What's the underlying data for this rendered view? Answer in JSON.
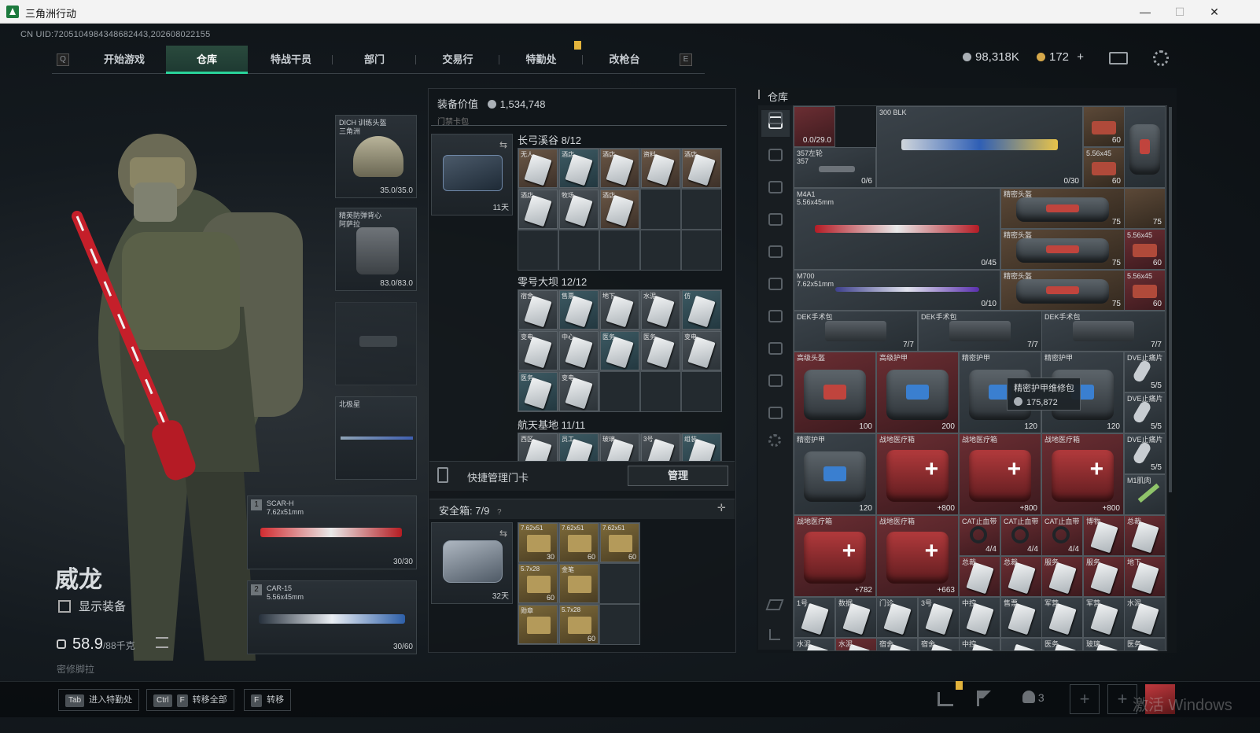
{
  "window": {
    "title": "三角洲行动",
    "minimize": "—",
    "maximize": "☐",
    "close": "✕"
  },
  "uid": "CN UID:7205104984348682443,202608022155",
  "nav": {
    "left_key": "Q",
    "right_key": "E",
    "tabs": [
      "开始游戏",
      "仓库",
      "特战干员",
      "部门",
      "交易行",
      "特勤处",
      "改枪台"
    ],
    "active": "仓库"
  },
  "currency": {
    "silver": "98,318K",
    "gold": "172",
    "gold_add": "+"
  },
  "character": {
    "name": "威龙",
    "show_equipment": "显示装备",
    "weight_value": "58.9",
    "weight_max": "/88千克",
    "secret_item": "密修脚拉"
  },
  "equipment": {
    "helmet": {
      "label": "DICH 训练头盔",
      "sub": "三角洲",
      "durability": "35.0/35.0"
    },
    "armor": {
      "label": "精英防弹背心",
      "sub": "阿萨拉",
      "durability": "83.0/83.0"
    },
    "melee": {
      "label": "北极星"
    },
    "primary1": {
      "slot": "1",
      "name": "SCAR-H",
      "caliber": "7.62x51mm",
      "ammo": "30/30"
    },
    "primary2": {
      "slot": "2",
      "name": "CAR-15",
      "caliber": "5.56x45mm",
      "ammo": "30/60"
    }
  },
  "middle": {
    "value_label": "装备价值",
    "value": "1,534,748",
    "collapsed_header": "门禁卡包",
    "card_bag_timer": "11天",
    "sections": [
      {
        "title": "长弓溪谷",
        "count": "8/12",
        "labels": [
          "无人",
          "酒店",
          "酒店",
          "资料",
          "酒店",
          "酒店",
          "牧场",
          "酒店"
        ]
      },
      {
        "title": "零号大坝",
        "count": "12/12",
        "labels": [
          "宿舍",
          "售票",
          "地下",
          "水泥",
          "仿",
          "变电",
          "中心",
          "医务",
          "医务",
          "变电",
          "医务",
          "变电"
        ]
      },
      {
        "title": "航天基地",
        "count": "11/11",
        "labels": [
          "西区",
          "员工",
          "玻璃",
          "3号",
          "组装"
        ]
      }
    ],
    "quick_manage_label": "快捷管理门卡",
    "manage_button": "管理",
    "safe_box_label": "安全箱",
    "safe_box_count": "7/9",
    "safe_box_help": "?",
    "safe_box_timer": "32天",
    "safe_items": [
      {
        "label": "7.62x51",
        "qty": "30"
      },
      {
        "label": "7.62x51",
        "qty": "60"
      },
      {
        "label": "7.62x51",
        "qty": "60"
      },
      {
        "label": "5.7x28",
        "qty": "60"
      },
      {
        "label": "金笔",
        "qty": ""
      },
      {
        "label": "勋章",
        "qty": ""
      },
      {
        "label": "5.7x28",
        "qty": "60"
      }
    ]
  },
  "warehouse": {
    "title": "仓库",
    "items": {
      "top_a": {
        "label": "",
        "value": "0.0/29.0"
      },
      "top_b": {
        "label": "300 BLK",
        "value": "0/30"
      },
      "top_c": {
        "label": "",
        "value": "60"
      },
      "pistol": {
        "label": "357左轮",
        "sub": "357",
        "value": "0/6"
      },
      "ammo_a": {
        "label": "5.56x45",
        "value": "60"
      },
      "m4a1": {
        "label": "M4A1",
        "sub": "5.56x45mm",
        "value": "0/45"
      },
      "m700": {
        "label": "M700",
        "sub": "7.62x51mm",
        "value": "0/10"
      },
      "kit1": {
        "label": "精密头盔",
        "value": "75"
      },
      "kit1b": {
        "label": "",
        "value": "75"
      },
      "kit2": {
        "label": "精密头盔",
        "value": "75"
      },
      "ammo_b": {
        "label": "5.56x45",
        "value": "60"
      },
      "kit3": {
        "label": "精密头盔",
        "value": "75"
      },
      "ammo_c": {
        "label": "5.56x45",
        "value": "60"
      },
      "dek1": {
        "label": "DEK手术包",
        "value": "7/7"
      },
      "dek2": {
        "label": "DEK手术包",
        "value": "7/7"
      },
      "dek3": {
        "label": "DEK手术包",
        "value": "7/7"
      },
      "row3_1": {
        "label": "高级头盔",
        "value": "100"
      },
      "row3_2": {
        "label": "高级护甲",
        "value": "200"
      },
      "row3_3": {
        "label": "精密护甲",
        "value": "120"
      },
      "row3_4": {
        "label": "精密护甲",
        "value": "120"
      },
      "dve1": {
        "label": "DVE止痛片",
        "value": "5/5"
      },
      "dve2": {
        "label": "DVE止痛片",
        "value": "5/5"
      },
      "row4_1": {
        "label": "精密护甲",
        "value": "120"
      },
      "row4_2": {
        "label": "战地医疗箱",
        "value": "+800"
      },
      "row4_3": {
        "label": "战地医疗箱",
        "value": "+800"
      },
      "row4_4": {
        "label": "战地医疗箱",
        "value": "+800"
      },
      "dve3": {
        "label": "DVE止痛片",
        "value": "5/5"
      },
      "m1": {
        "label": "M1肌肉",
        "value": ""
      },
      "row5_1": {
        "label": "战地医疗箱",
        "value": "+782"
      },
      "row5_2": {
        "label": "战地医疗箱",
        "value": "+663"
      },
      "cat1": {
        "label": "CAT止血带",
        "value": "4/4"
      },
      "cat2": {
        "label": "CAT止血带",
        "value": "4/4"
      },
      "cat3": {
        "label": "CAT止血带",
        "value": "4/4"
      },
      "misc1": {
        "label": "博物",
        "value": ""
      },
      "misc2": {
        "label": "总裁",
        "value": ""
      },
      "misc3": {
        "label": "总裁",
        "value": ""
      },
      "misc4": {
        "label": "总裁",
        "value": ""
      },
      "misc5": {
        "label": "服务",
        "value": ""
      },
      "misc6": {
        "label": "服务",
        "value": ""
      },
      "misc7": {
        "label": "地下",
        "value": ""
      }
    },
    "key_row": [
      "1号",
      "数据",
      "门诊",
      "3号",
      "中控",
      "售票",
      "军营",
      "军营",
      "水泥"
    ],
    "key_row2": [
      "水泥",
      "水泥",
      "宿舍",
      "宿舍",
      "中控",
      "",
      "医务",
      "玻璃",
      "医务"
    ],
    "tooltip": {
      "title": "精密护甲维修包",
      "value": "175,872"
    }
  },
  "bottom": {
    "hints": [
      {
        "key": "Tab",
        "key2": "",
        "label": "进入特勤处"
      },
      {
        "key": "Ctrl",
        "key2": "F",
        "label": "转移全部"
      },
      {
        "key": "F",
        "key2": "",
        "label": "转移"
      }
    ],
    "squad_count": "3",
    "watermark": "激活 Windows"
  }
}
